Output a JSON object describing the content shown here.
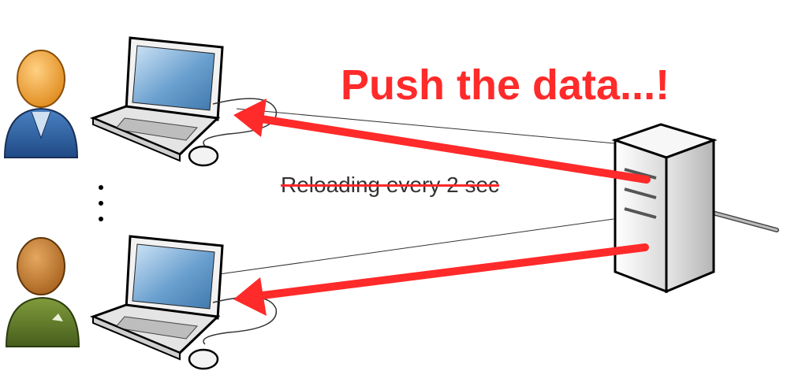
{
  "headline": "Push the data...!",
  "struck_text": "Reloading every 2 sec",
  "ellipsis": "⋮",
  "icons": [
    "user-icon",
    "laptop-icon",
    "mouse-icon",
    "server-icon"
  ],
  "colors": {
    "accent": "#ff2a2a",
    "user_top_body": "#2e5f9e",
    "user_bottom_body": "#5f7a2e",
    "screen": "#6aa0cf"
  }
}
